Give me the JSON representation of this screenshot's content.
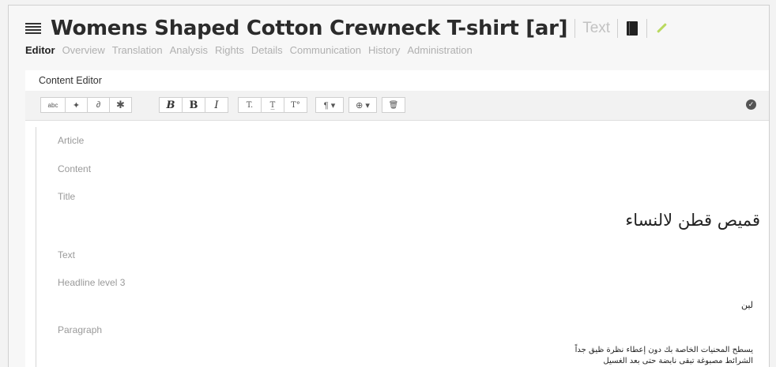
{
  "header": {
    "title": "Womens Shaped Cotton Crewneck T-shirt [ar]",
    "type_label": "Text",
    "icons": [
      "lines-icon",
      "book-icon",
      "pencil-icon"
    ],
    "pencil_color": "#b9d95f"
  },
  "tabs": [
    {
      "label": "Editor",
      "active": true
    },
    {
      "label": "Overview"
    },
    {
      "label": "Translation"
    },
    {
      "label": "Analysis"
    },
    {
      "label": "Rights"
    },
    {
      "label": "Details"
    },
    {
      "label": "Communication"
    },
    {
      "label": "History"
    },
    {
      "label": "Administration"
    }
  ],
  "panel": {
    "title": "Content Editor"
  },
  "toolbar": {
    "spellcheck": "abc",
    "pin": "✦",
    "link": "∂",
    "asterisk": "✱",
    "bold1": "B",
    "bold2": "B",
    "italic": "I",
    "subscript": "T.",
    "underline": "T̲",
    "superscript": "T°",
    "paragraph": "¶ ▾",
    "insert": "⊕ ▾",
    "delete": "🗑",
    "confirm": "✓"
  },
  "content": {
    "article_label": "Article",
    "content_label": "Content",
    "title_label": "Title",
    "title_text": "قميص قطن لالنساء",
    "text_label": "Text",
    "h3_label": "Headline level 3",
    "h3_text": "لين",
    "paragraph_label": "Paragraph",
    "paragraph_line1": "يسطح المحنيات الخاصة بك دون إعطاء نظرة ظيق جداً",
    "paragraph_line2": "الشرائط مصبوغة تبقى نابضة حتى بعد الغسيل"
  }
}
